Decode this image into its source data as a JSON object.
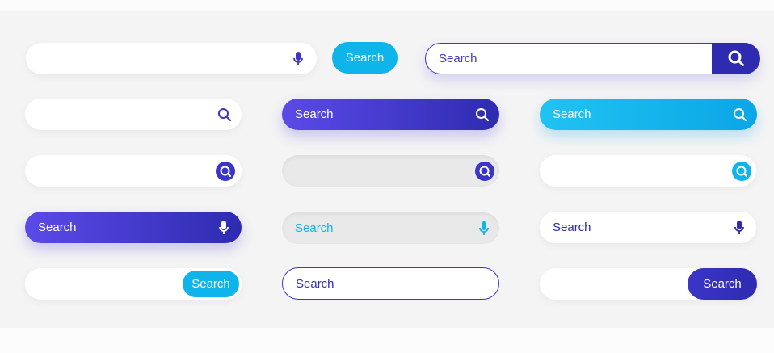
{
  "colors": {
    "purple": "#3b35c9",
    "cyan": "#0eb4ea",
    "white": "#ffffff",
    "gray": "#e9e9e9"
  },
  "icons": [
    "mic-icon",
    "search-icon"
  ],
  "labels": {
    "r1_button": "Search",
    "r1_bar3": "Search",
    "r2_bar2": "Search",
    "r2_bar3": "Search",
    "r4_bar1": "Search",
    "r4_bar2": "Search",
    "r4_bar3": "Search",
    "r5_button1": "Search",
    "r5_bar2": "Search",
    "r5_button3": "Search"
  }
}
